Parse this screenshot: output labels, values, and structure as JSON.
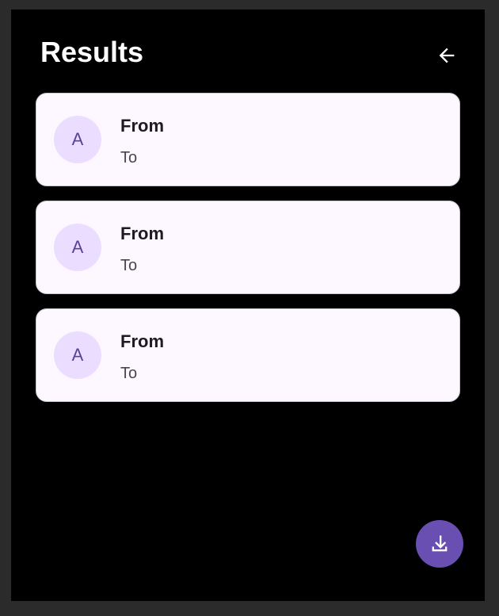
{
  "header": {
    "title": "Results",
    "back_icon": "arrow-left-icon"
  },
  "results": [
    {
      "avatar_letter": "A",
      "from": "From",
      "to": "To"
    },
    {
      "avatar_letter": "A",
      "from": "From",
      "to": "To"
    },
    {
      "avatar_letter": "A",
      "from": "From",
      "to": "To"
    }
  ],
  "fab": {
    "icon": "download-icon"
  },
  "colors": {
    "background": "#000000",
    "card": "#fdf7ff",
    "avatar_bg": "#eaddff",
    "avatar_text": "#5b3f9a",
    "fab": "#6a4fb3"
  }
}
